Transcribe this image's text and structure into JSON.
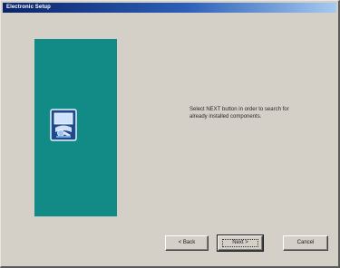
{
  "window": {
    "title": "Electronic Setup",
    "colors": {
      "titlebar": "#0a246a",
      "panel": "#128a85",
      "face": "#d4d0c8"
    }
  },
  "side_panel": {
    "icon": "setup-computer-icon"
  },
  "message": "Select NEXT button in order to search for already installed components.",
  "buttons": {
    "back": "< Back",
    "next": "Next >",
    "cancel": "Cancel"
  }
}
